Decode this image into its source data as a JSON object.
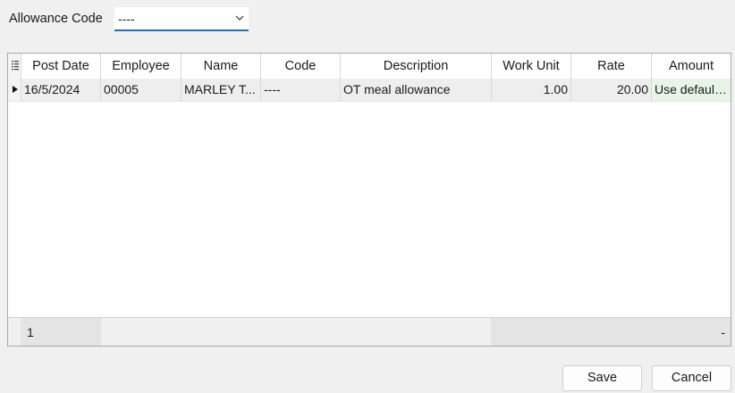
{
  "filter": {
    "label": "Allowance Code",
    "value": "----"
  },
  "grid": {
    "columns": [
      "Post Date",
      "Employee",
      "Name",
      "Code",
      "Description",
      "Work Unit",
      "Rate",
      "Amount"
    ],
    "rows": [
      {
        "post_date": "16/5/2024",
        "employee": "00005",
        "name": "MARLEY T...",
        "code": "----",
        "description": "OT meal allowance",
        "work_unit": "1.00",
        "rate": "20.00",
        "amount": "Use default..."
      }
    ],
    "footer": {
      "count": "1",
      "amount_total": "-"
    }
  },
  "buttons": {
    "save": "Save",
    "cancel": "Cancel"
  },
  "colors": {
    "accent": "#1e6fc0",
    "amount_cell": "#e6f6e6"
  }
}
